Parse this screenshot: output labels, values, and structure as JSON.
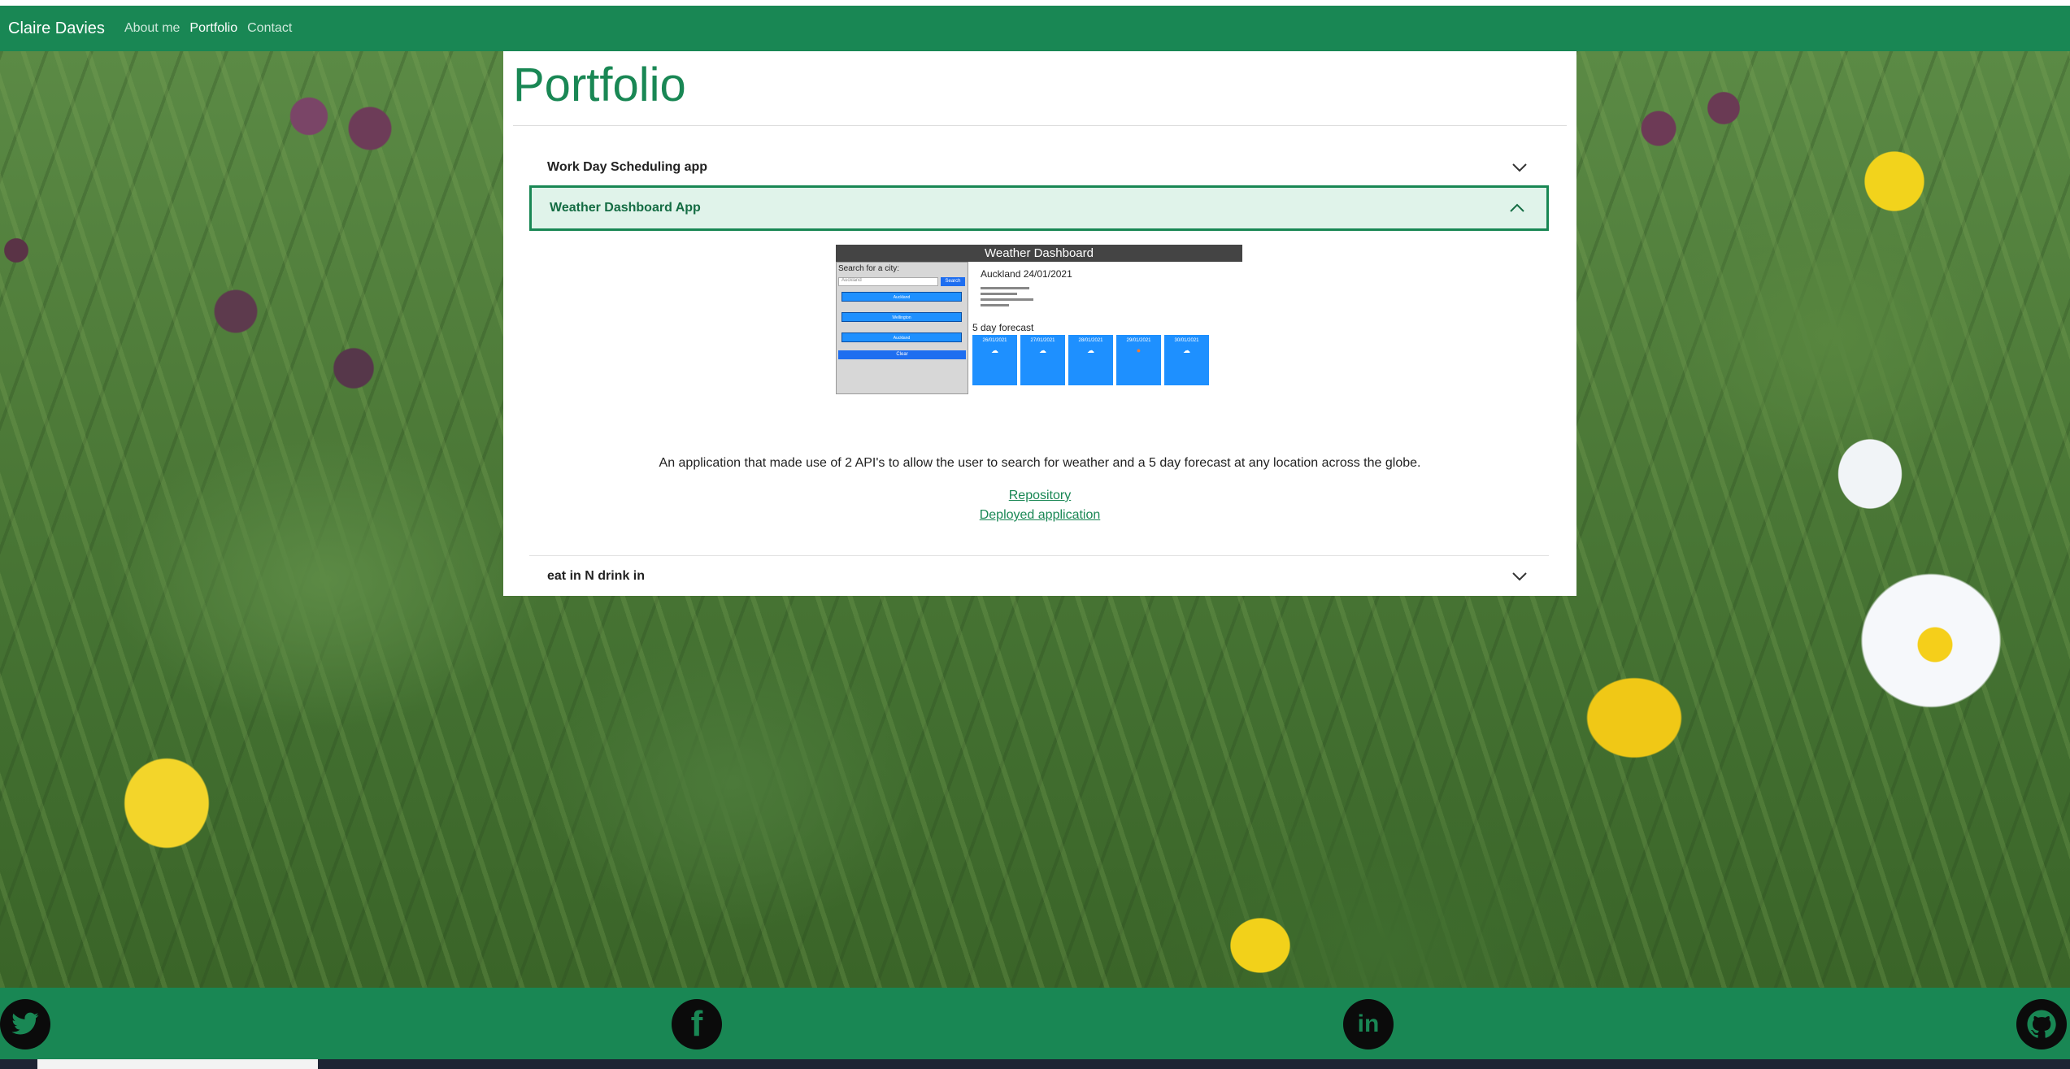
{
  "nav": {
    "brand": "Claire Davies",
    "links": [
      "About me",
      "Portfolio",
      "Contact"
    ],
    "active_link": "Portfolio"
  },
  "page": {
    "title": "Portfolio"
  },
  "accordion": {
    "items": [
      {
        "title": "Work Day Scheduling app",
        "expanded": false
      },
      {
        "title": "Weather Dashboard App",
        "expanded": true,
        "description": "An application that made use of 2 API's to allow the user to search for weather and a 5 day forecast at any location across the globe.",
        "links": [
          "Repository",
          "Deployed application"
        ],
        "screenshot": {
          "header": "Weather Dashboard",
          "search_label": "Search for a city:",
          "search_value": "Auckland",
          "search_button": "Search",
          "cities": [
            "Auckland",
            "Wellington",
            "Auckland"
          ],
          "clear_button": "Clear",
          "city_title": "Auckland 24/01/2021",
          "forecast_label": "5 day forecast",
          "forecast_dates": [
            "26/01/2021",
            "27/01/2021",
            "28/01/2021",
            "29/01/2021",
            "30/01/2021"
          ]
        }
      },
      {
        "title": "eat in N drink in",
        "expanded": false
      }
    ]
  },
  "footer": {
    "icons": [
      "twitter-icon",
      "facebook-icon",
      "linkedin-icon",
      "github-icon"
    ]
  },
  "colors": {
    "primary": "#198754",
    "active_bg": "#e0f3ea"
  }
}
